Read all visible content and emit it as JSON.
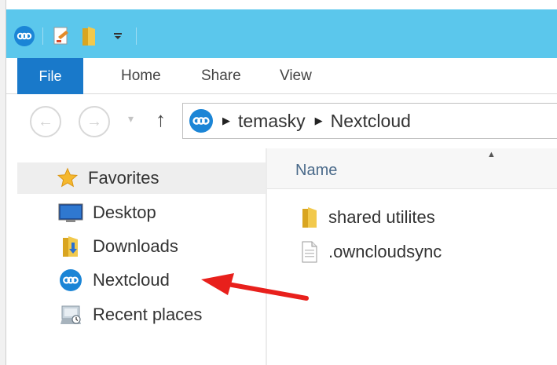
{
  "ribbon": {
    "file_tab": "File",
    "tabs": [
      "Home",
      "Share",
      "View"
    ]
  },
  "address": {
    "crumbs": [
      "temasky",
      "Nextcloud"
    ]
  },
  "navigation_pane": {
    "favorites_label": "Favorites",
    "items": [
      "Desktop",
      "Downloads",
      "Nextcloud",
      "Recent places"
    ]
  },
  "content": {
    "column_name": "Name",
    "files": [
      {
        "name": "shared utilites",
        "type": "folder"
      },
      {
        "name": ".owncloudsync",
        "type": "file"
      }
    ]
  },
  "colors": {
    "titlebar": "#5bc7ec",
    "file_tab": "#1979ca",
    "nextcloud_blue": "#1b85d6",
    "annotation_arrow": "#e8201c"
  },
  "icons": [
    "nextcloud-icon",
    "properties-icon",
    "new-folder-icon",
    "customize-dropdown-icon",
    "back-icon",
    "forward-icon",
    "up-icon",
    "star-icon",
    "desktop-icon",
    "downloads-icon",
    "recent-places-icon",
    "folder-icon",
    "document-icon",
    "sort-up-icon",
    "arrow-annotation-icon"
  ]
}
